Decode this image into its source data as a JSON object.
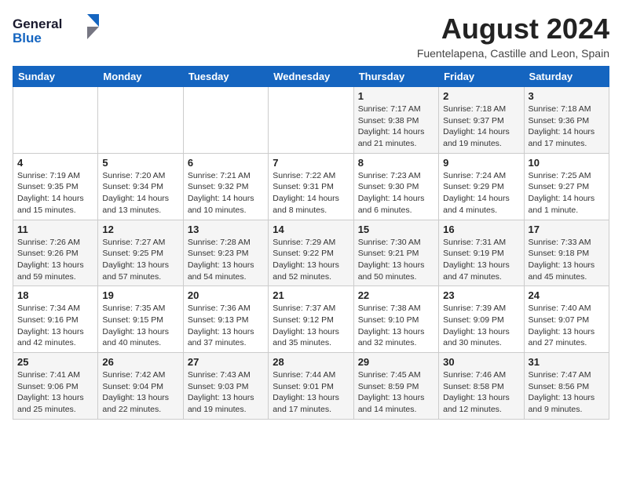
{
  "logo": {
    "line1": "General",
    "line2": "Blue"
  },
  "title": "August 2024",
  "location": "Fuentelapena, Castille and Leon, Spain",
  "weekdays": [
    "Sunday",
    "Monday",
    "Tuesday",
    "Wednesday",
    "Thursday",
    "Friday",
    "Saturday"
  ],
  "weeks": [
    [
      null,
      null,
      null,
      null,
      {
        "day": 1,
        "sunrise": "7:17 AM",
        "sunset": "9:38 PM",
        "daylight": "14 hours and 21 minutes."
      },
      {
        "day": 2,
        "sunrise": "7:18 AM",
        "sunset": "9:37 PM",
        "daylight": "14 hours and 19 minutes."
      },
      {
        "day": 3,
        "sunrise": "7:18 AM",
        "sunset": "9:36 PM",
        "daylight": "14 hours and 17 minutes."
      }
    ],
    [
      {
        "day": 4,
        "sunrise": "7:19 AM",
        "sunset": "9:35 PM",
        "daylight": "14 hours and 15 minutes."
      },
      {
        "day": 5,
        "sunrise": "7:20 AM",
        "sunset": "9:34 PM",
        "daylight": "14 hours and 13 minutes."
      },
      {
        "day": 6,
        "sunrise": "7:21 AM",
        "sunset": "9:32 PM",
        "daylight": "14 hours and 10 minutes."
      },
      {
        "day": 7,
        "sunrise": "7:22 AM",
        "sunset": "9:31 PM",
        "daylight": "14 hours and 8 minutes."
      },
      {
        "day": 8,
        "sunrise": "7:23 AM",
        "sunset": "9:30 PM",
        "daylight": "14 hours and 6 minutes."
      },
      {
        "day": 9,
        "sunrise": "7:24 AM",
        "sunset": "9:29 PM",
        "daylight": "14 hours and 4 minutes."
      },
      {
        "day": 10,
        "sunrise": "7:25 AM",
        "sunset": "9:27 PM",
        "daylight": "14 hours and 1 minute."
      }
    ],
    [
      {
        "day": 11,
        "sunrise": "7:26 AM",
        "sunset": "9:26 PM",
        "daylight": "13 hours and 59 minutes."
      },
      {
        "day": 12,
        "sunrise": "7:27 AM",
        "sunset": "9:25 PM",
        "daylight": "13 hours and 57 minutes."
      },
      {
        "day": 13,
        "sunrise": "7:28 AM",
        "sunset": "9:23 PM",
        "daylight": "13 hours and 54 minutes."
      },
      {
        "day": 14,
        "sunrise": "7:29 AM",
        "sunset": "9:22 PM",
        "daylight": "13 hours and 52 minutes."
      },
      {
        "day": 15,
        "sunrise": "7:30 AM",
        "sunset": "9:21 PM",
        "daylight": "13 hours and 50 minutes."
      },
      {
        "day": 16,
        "sunrise": "7:31 AM",
        "sunset": "9:19 PM",
        "daylight": "13 hours and 47 minutes."
      },
      {
        "day": 17,
        "sunrise": "7:33 AM",
        "sunset": "9:18 PM",
        "daylight": "13 hours and 45 minutes."
      }
    ],
    [
      {
        "day": 18,
        "sunrise": "7:34 AM",
        "sunset": "9:16 PM",
        "daylight": "13 hours and 42 minutes."
      },
      {
        "day": 19,
        "sunrise": "7:35 AM",
        "sunset": "9:15 PM",
        "daylight": "13 hours and 40 minutes."
      },
      {
        "day": 20,
        "sunrise": "7:36 AM",
        "sunset": "9:13 PM",
        "daylight": "13 hours and 37 minutes."
      },
      {
        "day": 21,
        "sunrise": "7:37 AM",
        "sunset": "9:12 PM",
        "daylight": "13 hours and 35 minutes."
      },
      {
        "day": 22,
        "sunrise": "7:38 AM",
        "sunset": "9:10 PM",
        "daylight": "13 hours and 32 minutes."
      },
      {
        "day": 23,
        "sunrise": "7:39 AM",
        "sunset": "9:09 PM",
        "daylight": "13 hours and 30 minutes."
      },
      {
        "day": 24,
        "sunrise": "7:40 AM",
        "sunset": "9:07 PM",
        "daylight": "13 hours and 27 minutes."
      }
    ],
    [
      {
        "day": 25,
        "sunrise": "7:41 AM",
        "sunset": "9:06 PM",
        "daylight": "13 hours and 25 minutes."
      },
      {
        "day": 26,
        "sunrise": "7:42 AM",
        "sunset": "9:04 PM",
        "daylight": "13 hours and 22 minutes."
      },
      {
        "day": 27,
        "sunrise": "7:43 AM",
        "sunset": "9:03 PM",
        "daylight": "13 hours and 19 minutes."
      },
      {
        "day": 28,
        "sunrise": "7:44 AM",
        "sunset": "9:01 PM",
        "daylight": "13 hours and 17 minutes."
      },
      {
        "day": 29,
        "sunrise": "7:45 AM",
        "sunset": "8:59 PM",
        "daylight": "13 hours and 14 minutes."
      },
      {
        "day": 30,
        "sunrise": "7:46 AM",
        "sunset": "8:58 PM",
        "daylight": "13 hours and 12 minutes."
      },
      {
        "day": 31,
        "sunrise": "7:47 AM",
        "sunset": "8:56 PM",
        "daylight": "13 hours and 9 minutes."
      }
    ]
  ]
}
